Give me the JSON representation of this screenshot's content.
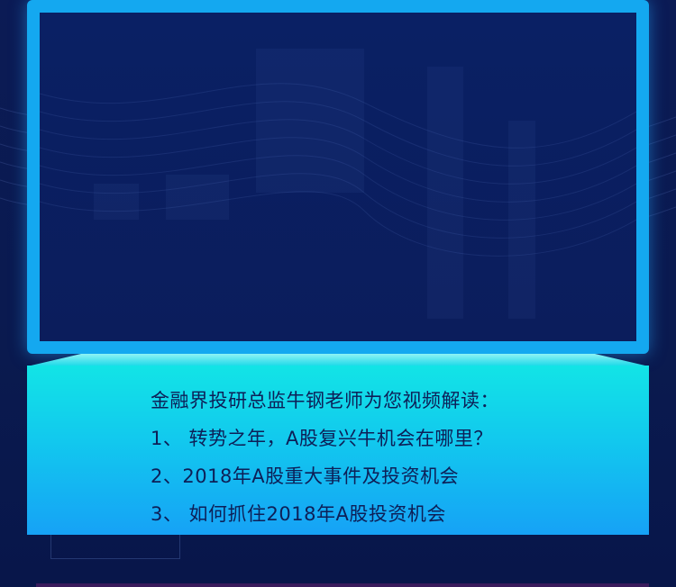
{
  "info": {
    "title": "金融界投研总监牛钢老师为您视频解读：",
    "items": [
      "1、 转势之年，A股复兴牛机会在哪里？",
      "2、2018年A股重大事件及投资机会",
      "3、 如何抓住2018年A股投资机会"
    ]
  },
  "colors": {
    "background": "#0a1a4f",
    "frame": "#14a8f0",
    "screen": "#0b1d5c",
    "panel_top": "#12e4e6",
    "panel_bottom": "#16a2f6",
    "text": "#0d1f57"
  }
}
